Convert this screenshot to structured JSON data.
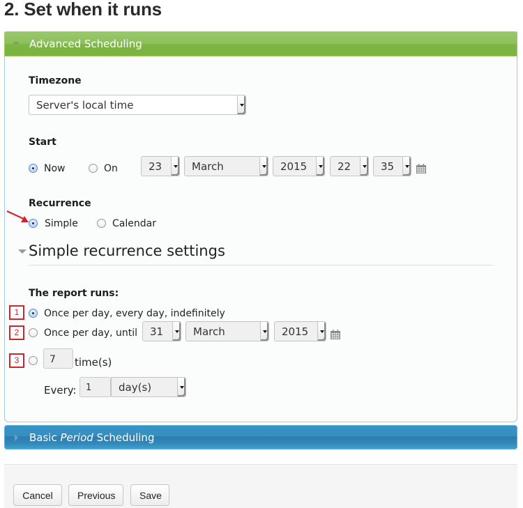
{
  "page": {
    "title": "2. Set when it runs"
  },
  "advanced_panel": {
    "title": "Advanced Scheduling",
    "timezone": {
      "label": "Timezone",
      "selected": "Server's local time"
    },
    "start": {
      "label": "Start",
      "options": [
        {
          "label": "Now",
          "checked": true
        },
        {
          "label": "On",
          "checked": false
        }
      ],
      "day": "23",
      "month": "March",
      "year": "2015",
      "hour": "22",
      "minute": "35",
      "calendar_icon": "calendar-icon"
    },
    "recurrence": {
      "label": "Recurrence",
      "options": [
        {
          "label": "Simple",
          "checked": true
        },
        {
          "label": "Calendar",
          "checked": false
        }
      ],
      "annotation_color": "#d0252a"
    },
    "simple_settings": {
      "title": "Simple recurrence settings",
      "runs_label": "The report runs:",
      "options": [
        {
          "badge": "1",
          "label": "Once per day, every day, indefinitely",
          "checked": true
        },
        {
          "badge": "2",
          "label": "Once per day, until",
          "checked": false,
          "day": "31",
          "month": "March",
          "year": "2015"
        },
        {
          "badge": "3",
          "checked": false,
          "count": "7",
          "count_suffix": "time(s)"
        }
      ],
      "every_label": "Every:",
      "every_value": "1",
      "every_unit": "day(s)"
    }
  },
  "basic_panel": {
    "title_prefix": "Basic ",
    "title_italic": "Period",
    "title_suffix": " Scheduling"
  },
  "footer": {
    "cancel_label": "Cancel",
    "previous_label": "Previous",
    "save_label": "Save"
  },
  "colors": {
    "green_header": "#7db543",
    "blue_header": "#3590bf",
    "badge_red": "#d0252a"
  }
}
